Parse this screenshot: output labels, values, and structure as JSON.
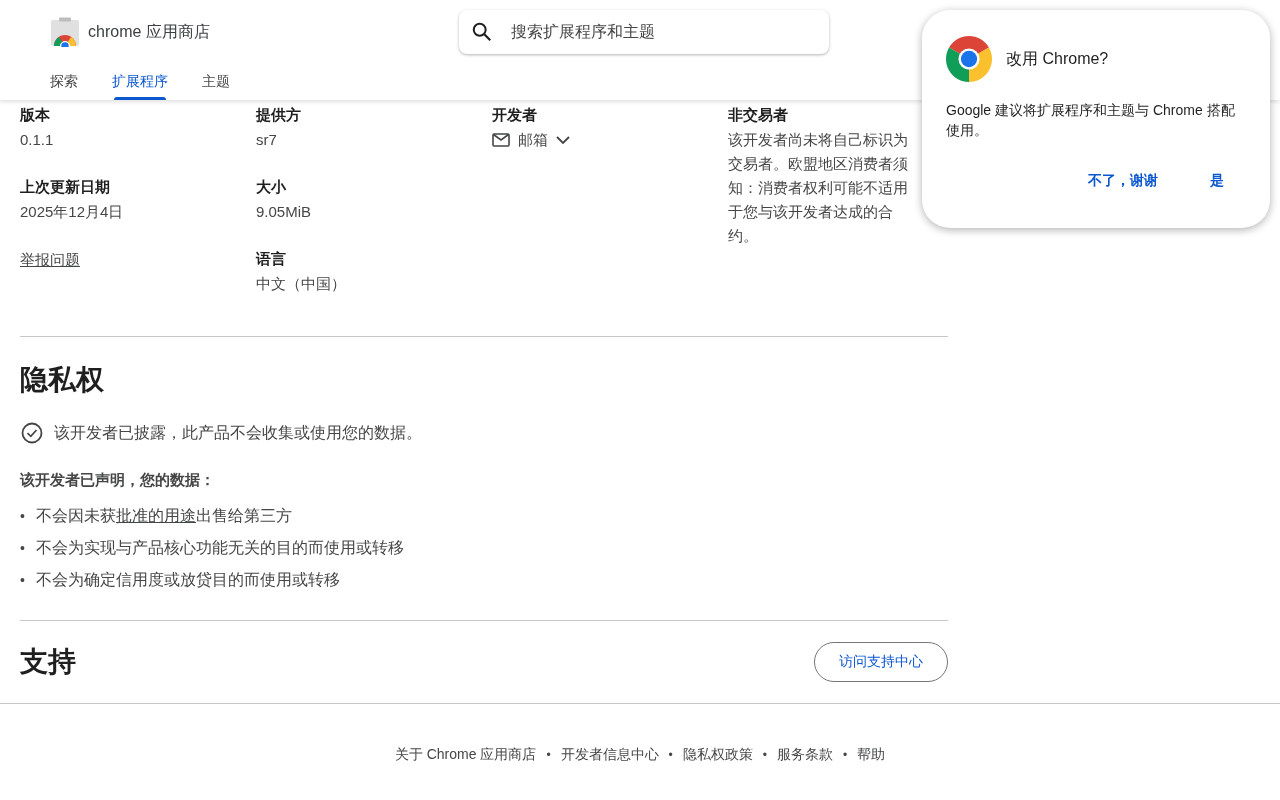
{
  "header": {
    "store_name": "chrome 应用商店",
    "search": {
      "placeholder": "搜索扩展程序和主题"
    },
    "tabs": [
      {
        "label": "探索",
        "selected": false
      },
      {
        "label": "扩展程序",
        "selected": true
      },
      {
        "label": "主题",
        "selected": false
      }
    ]
  },
  "details": {
    "columns": [
      [
        {
          "kind": "text",
          "label": "版本",
          "value": "0.1.1"
        },
        {
          "kind": "text",
          "label": "上次更新日期",
          "value": "2025年12月4日"
        },
        {
          "kind": "link",
          "value": "举报问题"
        }
      ],
      [
        {
          "kind": "text",
          "label": "提供方",
          "value": "sr7"
        },
        {
          "kind": "text",
          "label": "大小",
          "value": "9.05MiB"
        },
        {
          "kind": "text",
          "label": "语言",
          "value": "中文（中国）"
        }
      ],
      [
        {
          "kind": "dropdown",
          "label": "开发者",
          "value": "邮箱"
        }
      ],
      [
        {
          "kind": "text",
          "label": "非交易者",
          "value": "该开发者尚未将自己标识为交易者。欧盟地区消费者须知：消费者权利可能不适用于您与该开发者达成的合约。"
        }
      ]
    ]
  },
  "privacy": {
    "title": "隐私权",
    "disclosure": "该开发者已披露，此产品不会收集或使用您的数据。",
    "declared_heading": "该开发者已声明，您的数据：",
    "bullet": "•",
    "items": [
      {
        "text": "不会因未获",
        "link": "批准的用途",
        "after": "出售给第三方"
      },
      {
        "text": "不会为实现与产品核心功能无关的目的而使用或转移"
      },
      {
        "text": "不会为确定信用度或放贷目的而使用或转移"
      }
    ]
  },
  "support": {
    "title": "支持",
    "button": "访问支持中心"
  },
  "footer": {
    "links": [
      "关于 Chrome 应用商店",
      "开发者信息中心",
      "隐私权政策",
      "服务条款",
      "帮助"
    ],
    "separator": "•"
  },
  "dialog": {
    "title": "改用 Chrome?",
    "body": "Google 建议将扩展程序和主题与 Chrome 搭配使用。",
    "buttons": [
      "不了，谢谢",
      "是"
    ]
  }
}
